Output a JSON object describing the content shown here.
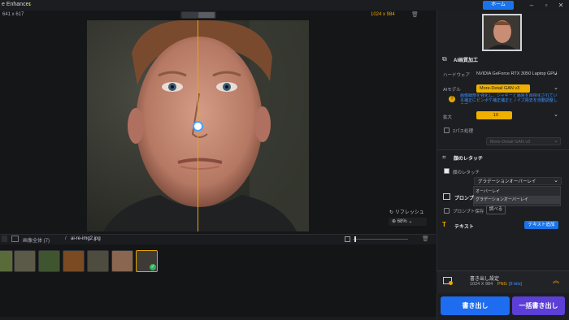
{
  "app": {
    "title": "e Enhancer",
    "home_label": "ホーム"
  },
  "canvas": {
    "source_size": "641 x 617",
    "output_size": "1024 x 984",
    "refresh_label": "リフレッシュ",
    "zoom": "68%"
  },
  "strip": {
    "all_images": "画像全体 (7)",
    "separator": "/",
    "current_file": "ai-re-img2.jpg",
    "thumb_count": 7
  },
  "panel": {
    "ai_section": "AI画質加工",
    "hardware_label": "ハードウェア",
    "hardware_value": "NVIDIA GeForce RTX 3050 Laptop GPU",
    "model_label": "AIモデル",
    "model_value": "More-Detail GAN  v3",
    "model_hint": "画像細部を強化し、ジャギーと画質を目標化されている補正にピンボケ補正補正とノイズ除去を自動調整します。",
    "scale_label": "拡大",
    "scale_value": "1X",
    "second_pass_label": "2パス処理",
    "second_pass_value": "More-Detail GAN  v3",
    "retouch_section": "顔のレタッチ",
    "retouch_checkbox": "顔のレタッチ",
    "retouch_select": "グラデーションオーバーレイ",
    "menu_items": [
      "オーバーレイ",
      "グラデーションオーバーレイ"
    ],
    "prompt_section": "プロンプ",
    "prompt_save": "プロンプト保存",
    "prompt_check": "調べる",
    "text_section": "テキスト",
    "text_add": "テキスト追加",
    "export_title": "書き出し設定",
    "export_size": "1024 X 984",
    "export_format": "PNG",
    "export_bits": "[8 bits]",
    "export_button": "書き出し",
    "batch_button": "一括書き出し"
  },
  "colors": {
    "accent": "#1a73e8",
    "highlight": "#e8a800",
    "batch": "#5b3fd6"
  }
}
